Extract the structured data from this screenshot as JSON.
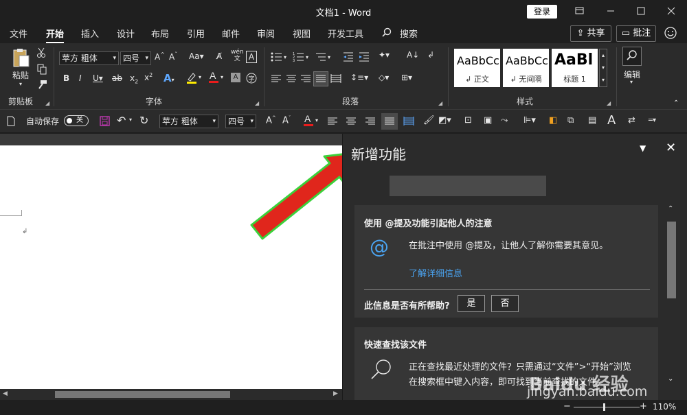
{
  "window": {
    "title": "文档1  -  Word",
    "login_label": "登录",
    "controls": [
      "restore-icon",
      "minimize-icon",
      "maximize-icon",
      "close-icon"
    ]
  },
  "menu": {
    "tabs": [
      "文件",
      "开始",
      "插入",
      "设计",
      "布局",
      "引用",
      "邮件",
      "审阅",
      "视图",
      "开发工具"
    ],
    "active": "开始",
    "search_label": "搜索",
    "share_label": "共享",
    "comment_label": "批注"
  },
  "ribbon": {
    "clipboard": {
      "paste_label": "粘贴",
      "group_label": "剪贴板"
    },
    "font": {
      "font_name": "苹方 粗体",
      "font_size": "四号",
      "group_label": "字体"
    },
    "paragraph": {
      "group_label": "段落"
    },
    "styles": {
      "group_label": "样式",
      "items": [
        {
          "sample": "AaBbCcI",
          "name": "↲ 正文"
        },
        {
          "sample": "AaBbCcI",
          "name": "↲ 无间隔"
        },
        {
          "sample": "AaBl",
          "name": "标题 1"
        }
      ]
    },
    "editing": {
      "label": "编辑"
    }
  },
  "qat": {
    "autosave_label": "自动保存",
    "autosave_state": "关",
    "font_name": "苹方 粗体",
    "font_size": "四号"
  },
  "pane": {
    "title": "新增功能",
    "card1": {
      "title": "使用 @提及功能引起他人的注意",
      "body": "在批注中使用 @提及，让他人了解你需要其意见。",
      "link": "了解详细信息",
      "question": "此信息是否有所帮助?",
      "yes": "是",
      "no": "否"
    },
    "card2": {
      "title": "快速查找该文件",
      "body_line1": "正在查找最近处理的文件？只需通过“文件”>“开始”浏览",
      "body_line2": "在搜索框中键入内容，即可找到当前查找的文件。"
    }
  },
  "status": {
    "zoom": "110%"
  },
  "watermark": {
    "brand": "Baidu 经验",
    "url": "jingyan.baidu.com"
  },
  "colors": {
    "accent_link": "#4aa3f0",
    "arrow_fill": "#e0261c",
    "arrow_outline": "#3bd13b"
  }
}
